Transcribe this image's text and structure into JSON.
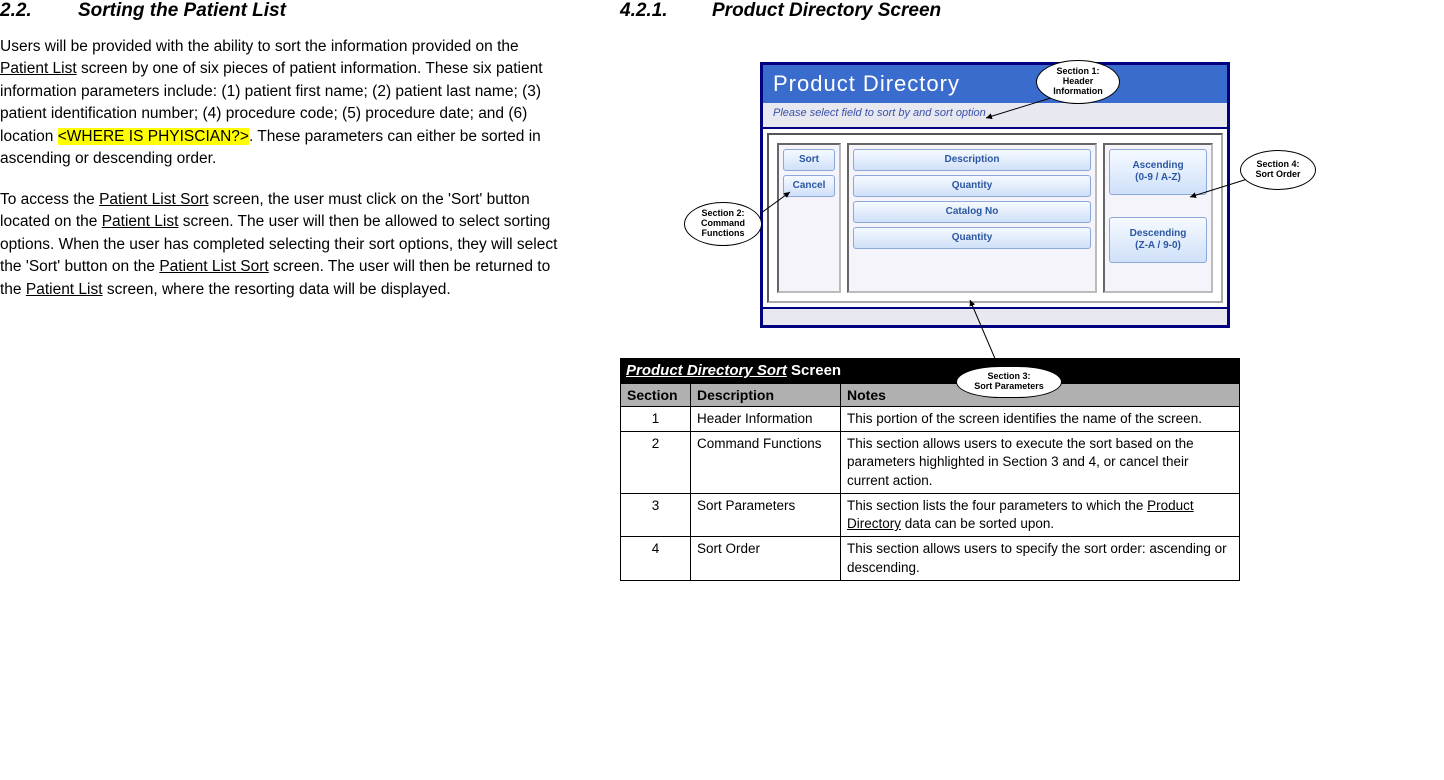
{
  "left": {
    "heading_num": "2.2.",
    "heading_text": "Sorting the Patient List",
    "p1_a": "Users will be provided with the ability to sort the information provided on the ",
    "p1_link1": "Patient List",
    "p1_b": " screen by one of six pieces of patient information.  These six patient information parameters include: (1) patient first name; (2) patient last name; (3) patient identification number; (4) procedure code; (5) procedure date; and (6) location ",
    "p1_mark": "<WHERE IS PHYISCIAN?>",
    "p1_c": ".  These parameters can either be sorted in ascending or descending order.",
    "p2_a": "To access the ",
    "p2_link1": "Patient List Sort",
    "p2_b": " screen, the user must click on the 'Sort' button located on the ",
    "p2_link2": "Patient List",
    "p2_c": " screen.  The user will then be allowed to select sorting options.  When the user has completed selecting their sort options, they will select the 'Sort' button on the ",
    "p2_link3": "Patient List Sort",
    "p2_d": " screen.  The user will then be returned to the ",
    "p2_link4": "Patient List",
    "p2_e": " screen, where the resorting data will be displayed."
  },
  "right": {
    "heading_num": "4.2.1.",
    "heading_text": "Product Directory Screen"
  },
  "mock": {
    "header": "Product Directory",
    "sub": "Please select field to sort by and sort option",
    "cmd": {
      "sort": "Sort",
      "cancel": "Cancel"
    },
    "params": [
      "Description",
      "Quantity",
      "Catalog No",
      "Quantity"
    ],
    "order": {
      "asc_a": "Ascending",
      "asc_b": "(0-9 / A-Z)",
      "desc_a": "Descending",
      "desc_b": "(Z-A / 9-0)"
    }
  },
  "callouts": {
    "s1a": "Section 1:",
    "s1b": "Header",
    "s1c": "Information",
    "s2a": "Section 2:",
    "s2b": "Command",
    "s2c": "Functions",
    "s3a": "Section 3:",
    "s3b": "Sort Parameters",
    "s4a": "Section 4:",
    "s4b": "Sort Order"
  },
  "table": {
    "caption_em": "Product Directory Sort",
    "caption_plain": " Screen",
    "headers": [
      "Section",
      "Description",
      "Notes"
    ],
    "rows": [
      {
        "sec": "1",
        "desc": "Header Information",
        "notes": "This portion of the screen identifies the name of the screen."
      },
      {
        "sec": "2",
        "desc": "Command Functions",
        "notes": "This section allows users to execute the sort based on the parameters highlighted in Section 3 and 4, or cancel their current action."
      },
      {
        "sec": "3",
        "desc": "Sort Parameters",
        "notes_a": "This section lists the four parameters to which the ",
        "notes_link": "Product Directory",
        "notes_b": " data can be sorted upon."
      },
      {
        "sec": "4",
        "desc": "Sort Order",
        "notes": "This section allows users to specify the sort order: ascending or descending."
      }
    ]
  }
}
